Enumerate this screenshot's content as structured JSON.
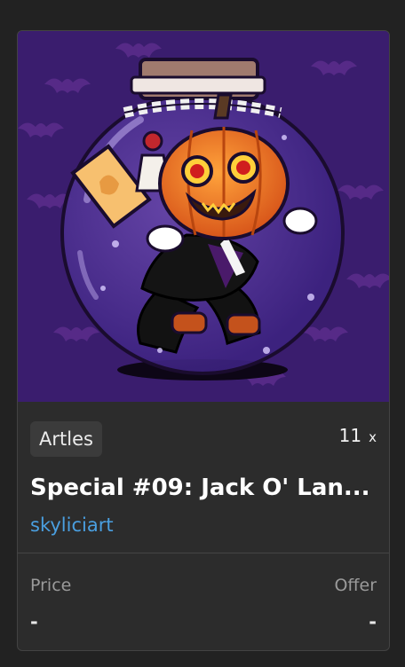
{
  "colors": {
    "background": "#222222",
    "card": "#2c2c2c",
    "artwork_background": "#3a1d6e",
    "creator_link": "#4a9fe0"
  },
  "card": {
    "collection": "Artles",
    "quantity": "11",
    "quantity_suffix": "x",
    "title": "Special #09: Jack O' Lan...",
    "creator": "skyliciart",
    "price_label": "Price",
    "price_value": "-",
    "offer_label": "Offer",
    "offer_value": "-"
  }
}
